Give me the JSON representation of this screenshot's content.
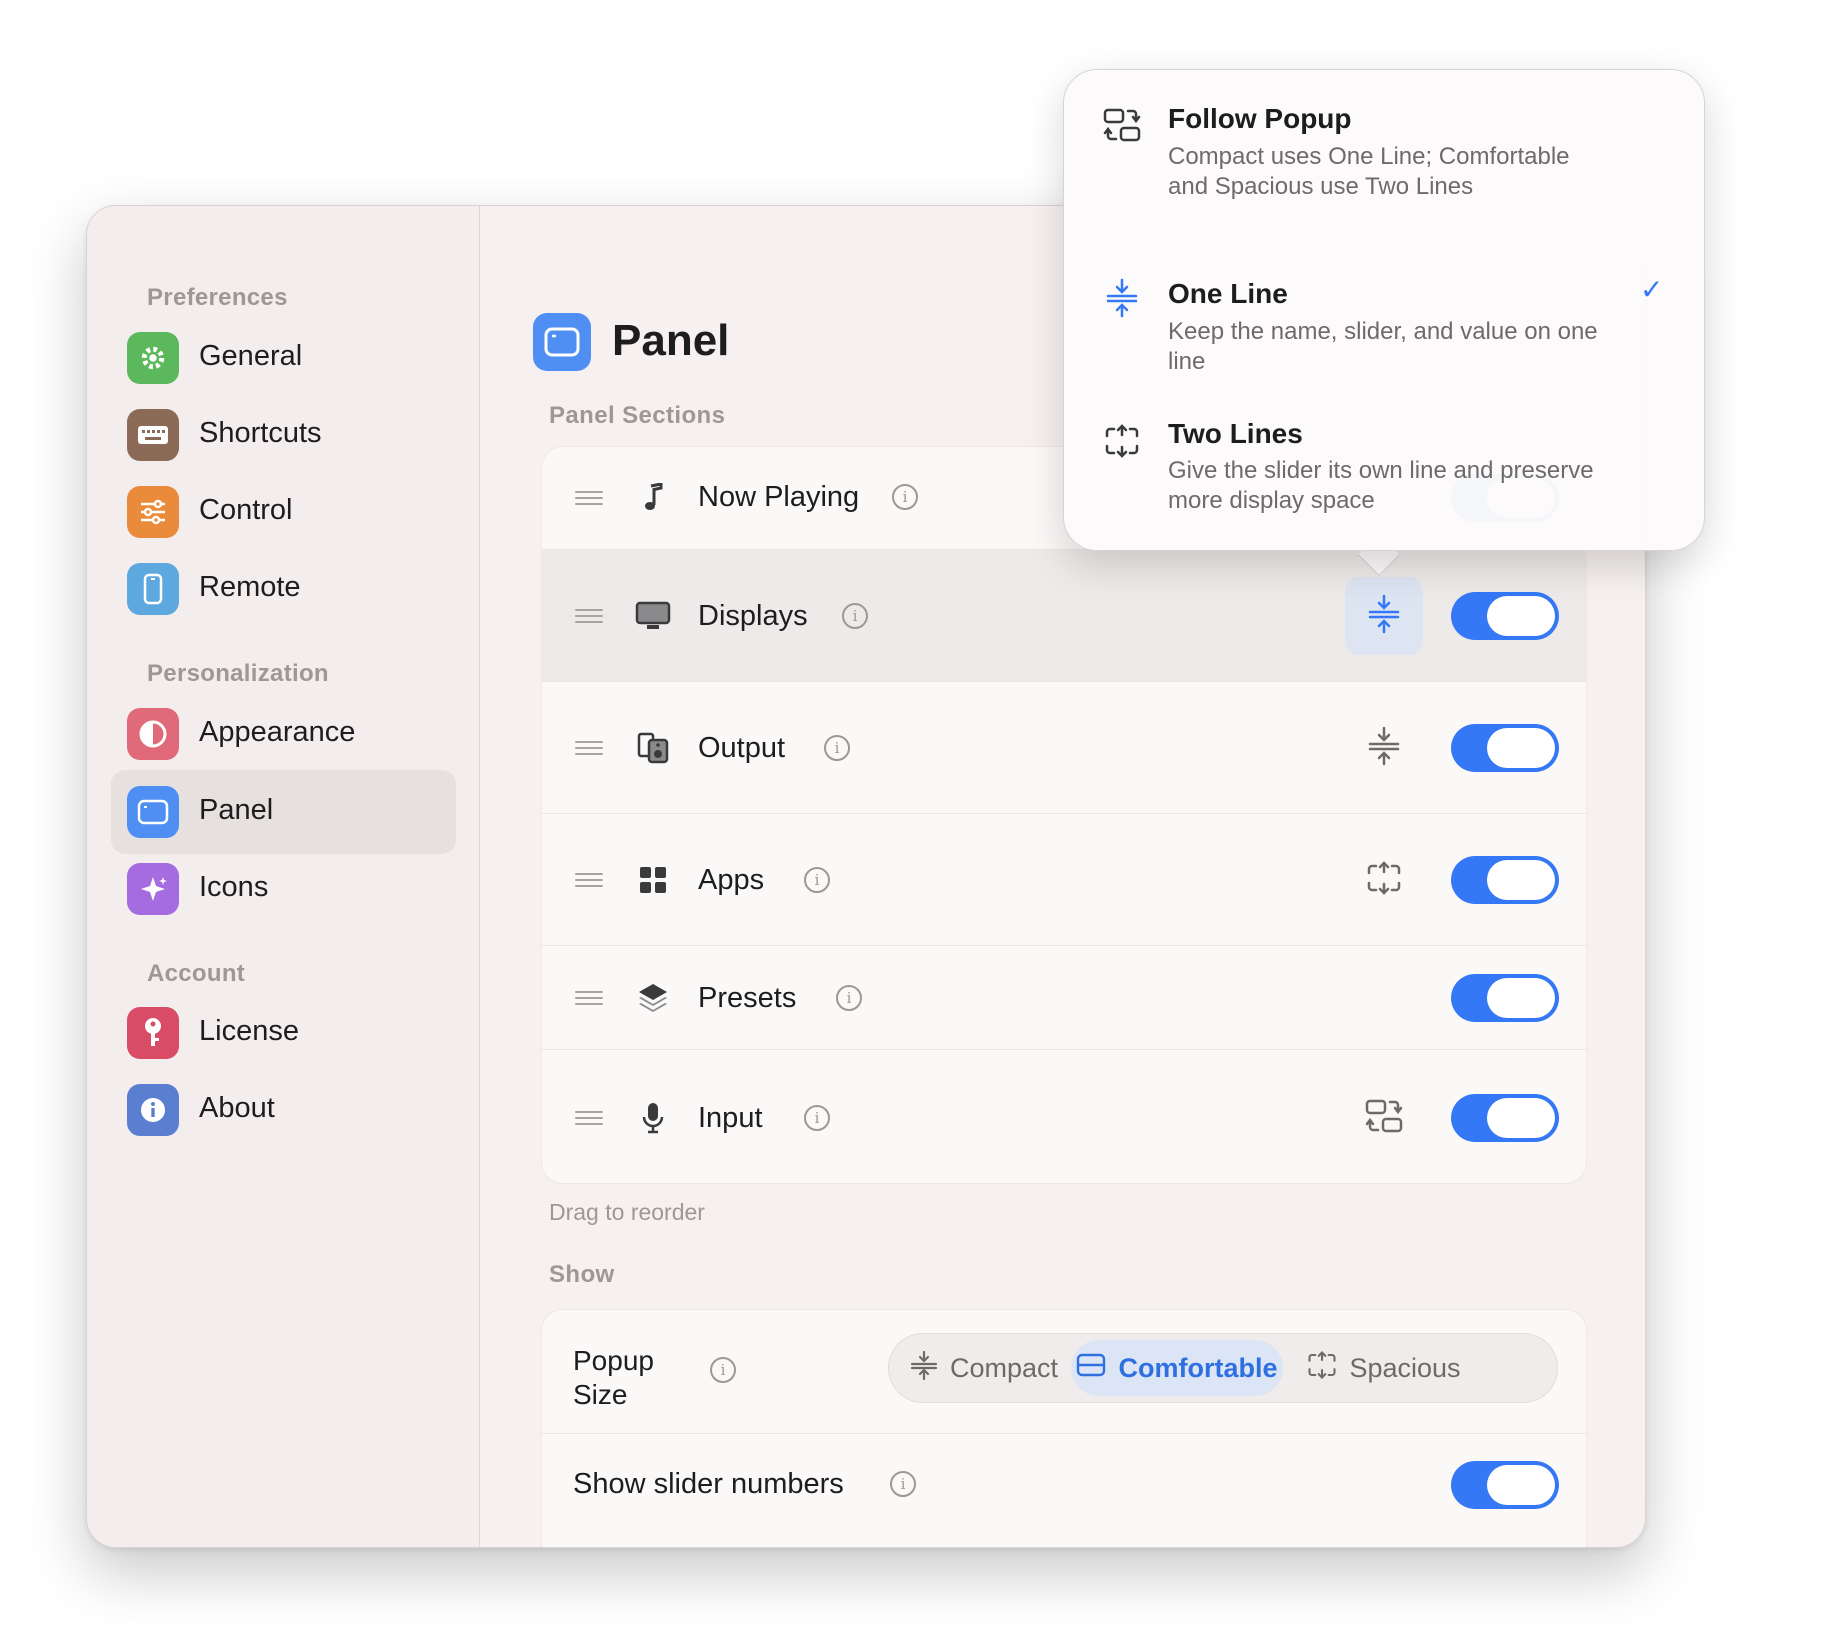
{
  "sidebar": {
    "sections": [
      {
        "title": "Preferences"
      },
      {
        "title": "Personalization"
      },
      {
        "title": "Account"
      }
    ],
    "items": [
      {
        "label": "General",
        "icon": "gear-icon",
        "color": "#5cb85c"
      },
      {
        "label": "Shortcuts",
        "icon": "keyboard-icon",
        "color": "#8b6b57"
      },
      {
        "label": "Control",
        "icon": "sliders-icon",
        "color": "#ea8b3c"
      },
      {
        "label": "Remote",
        "icon": "phone-icon",
        "color": "#5ea8e0"
      },
      {
        "label": "Appearance",
        "icon": "contrast-icon",
        "color": "#e06a7a"
      },
      {
        "label": "Panel",
        "icon": "window-icon",
        "color": "#4f8ef2"
      },
      {
        "label": "Icons",
        "icon": "sparkles-icon",
        "color": "#a56be0"
      },
      {
        "label": "License",
        "icon": "key-icon",
        "color": "#d94c66"
      },
      {
        "label": "About",
        "icon": "info-icon",
        "color": "#5a7fd0"
      }
    ],
    "active": "Panel"
  },
  "main": {
    "title": "Panel",
    "sections_label": "Panel Sections",
    "rows": [
      {
        "label": "Now Playing",
        "icon": "music-note-icon",
        "toggle": true
      },
      {
        "label": "Displays",
        "icon": "monitor-icon",
        "layout": "one-line-icon",
        "toggle": true,
        "selected": true
      },
      {
        "label": "Output",
        "icon": "speaker-icon",
        "layout": "one-line-icon",
        "toggle": true
      },
      {
        "label": "Apps",
        "icon": "grid-icon",
        "layout": "two-lines-icon",
        "toggle": true
      },
      {
        "label": "Presets",
        "icon": "layers-icon",
        "toggle": true
      },
      {
        "label": "Input",
        "icon": "microphone-icon",
        "layout": "follow-popup-icon",
        "toggle": true
      }
    ],
    "reorder_hint": "Drag to reorder",
    "show_label": "Show",
    "popup_size": {
      "label": "Popup Size",
      "options": [
        "Compact",
        "Comfortable",
        "Spacious"
      ],
      "selected": "Comfortable"
    },
    "show_slider_numbers": {
      "label": "Show slider numbers",
      "on": true
    }
  },
  "popover": {
    "options": [
      {
        "title": "Follow Popup",
        "desc": "Compact uses One Line; Comfortable and Spacious use Two Lines",
        "checked": false
      },
      {
        "title": "One Line",
        "desc": "Keep the name, slider, and value on one line",
        "checked": true
      },
      {
        "title": "Two Lines",
        "desc": "Give the slider its own line and preserve more display space",
        "checked": false
      }
    ],
    "check_glyph": "✓"
  },
  "colors": {
    "accent": "#3478f6",
    "close": "#ee5a52"
  }
}
